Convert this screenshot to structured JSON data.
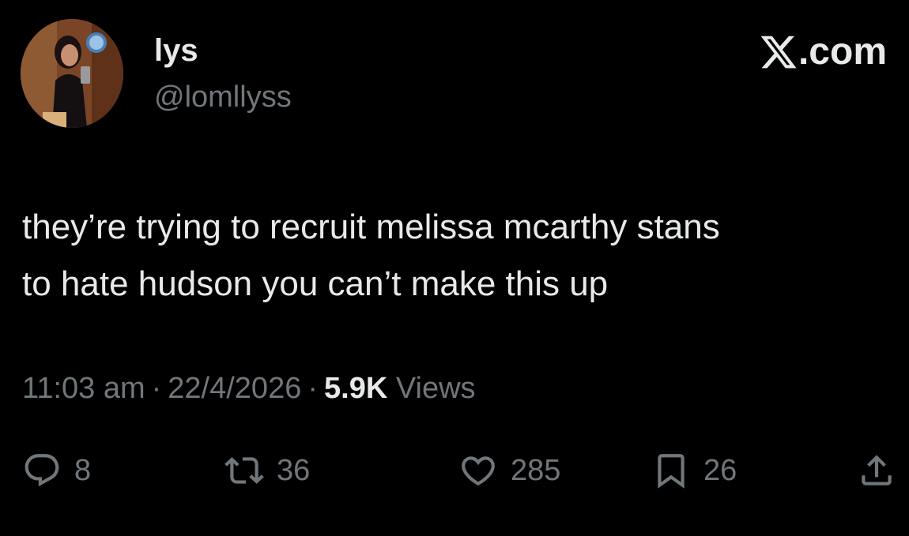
{
  "author": {
    "display_name": "lys",
    "handle": "@lomllyss",
    "avatar_icon": "profile-photo"
  },
  "brand": {
    "text": ".com",
    "icon": "x-logo-icon"
  },
  "tweet": {
    "line1": "they’re trying to recruit melissa mcarthy stans",
    "line2": "to hate hudson you can’t make this up"
  },
  "meta": {
    "time": "11:03 am",
    "date": "22/4/2026",
    "views_count": "5.9K",
    "views_label": "Views"
  },
  "actions": {
    "replies": "8",
    "reposts": "36",
    "likes": "285",
    "bookmarks": "26"
  },
  "colors": {
    "background": "#000000",
    "primary_text": "#e7e9ea",
    "secondary_text": "#71767b"
  }
}
